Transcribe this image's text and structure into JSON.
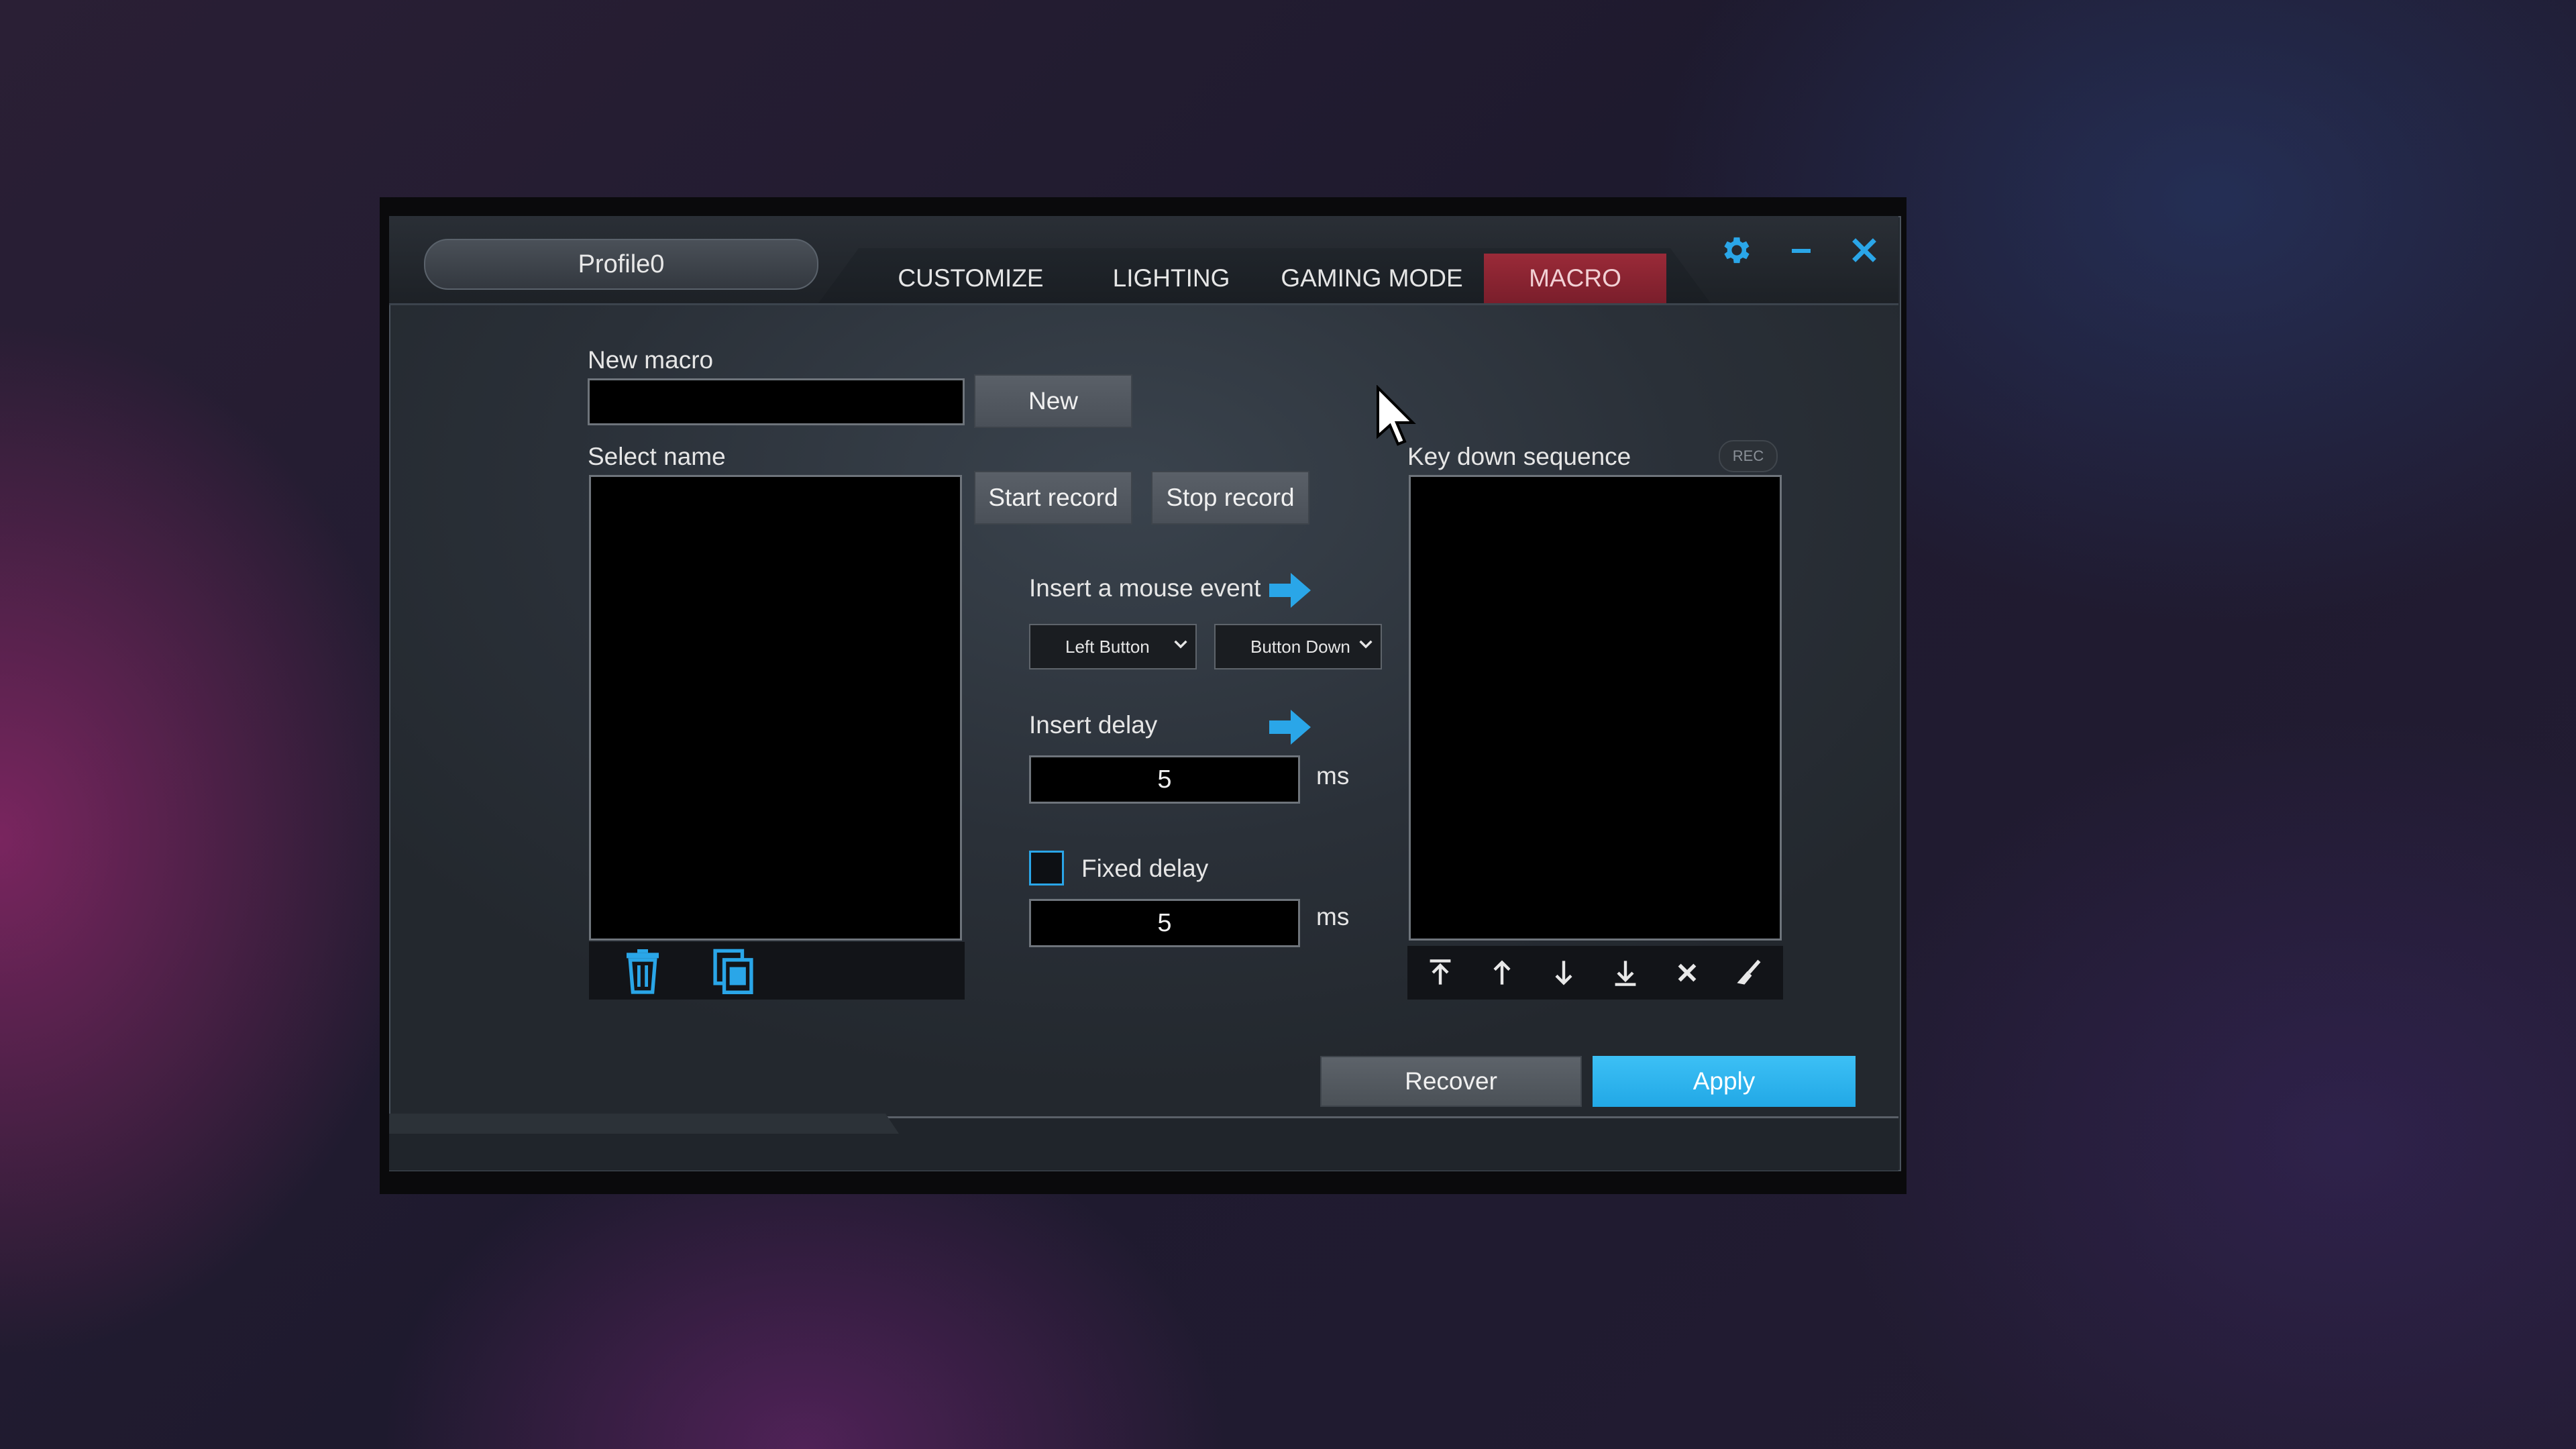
{
  "window": {
    "profile_name": "Profile0",
    "tabs": [
      {
        "label": "CUSTOMIZE"
      },
      {
        "label": "LIGHTING"
      },
      {
        "label": "GAMING MODE"
      },
      {
        "label": "MACRO",
        "active": true
      }
    ],
    "controls": {
      "settings_icon": "gear-icon",
      "minimize_icon": "minimize-icon",
      "close_icon": "close-icon"
    },
    "accent_color": "#2aa6e8",
    "active_tab_color": "#8a2432"
  },
  "macro": {
    "new_macro_label": "New macro",
    "new_macro_value": "",
    "new_button": "New",
    "select_name_label": "Select name",
    "start_record": "Start record",
    "stop_record": "Stop record",
    "insert_mouse_event_label": "Insert a mouse event",
    "mouse_button_selected": "Left Button",
    "mouse_action_selected": "Button Down",
    "insert_delay_label": "Insert delay",
    "delay_value": "5",
    "delay_unit": "ms",
    "fixed_delay_label": "Fixed delay",
    "fixed_delay_checked": false,
    "fixed_delay_value": "5",
    "fixed_delay_unit": "ms",
    "key_down_sequence_label": "Key down sequence",
    "rec_badge": "REC",
    "list_tools": [
      "trash-icon",
      "copy-icon"
    ],
    "sequence_tools": [
      "move-top-icon",
      "move-up-icon",
      "move-down-icon",
      "move-bottom-icon",
      "delete-icon",
      "clear-icon"
    ]
  },
  "footer": {
    "recover": "Recover",
    "apply": "Apply"
  }
}
